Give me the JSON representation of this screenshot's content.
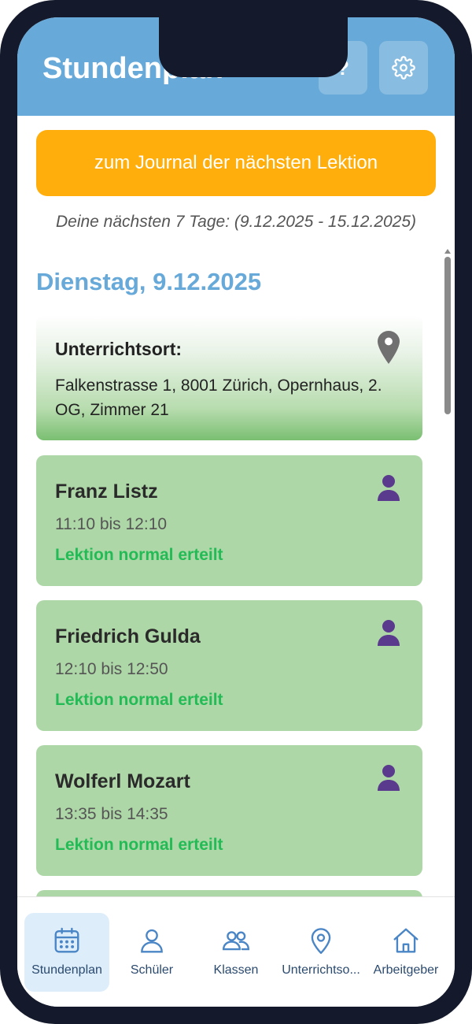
{
  "header": {
    "title": "Stundenplan",
    "help_label": "?"
  },
  "journal_button_label": "zum Journal der nächsten Lektion",
  "range_text": "Deine nächsten 7 Tage: (9.12.2025 - 15.12.2025)",
  "day_heading": "Dienstag, 9.12.2025",
  "location": {
    "label": "Unterrichtsort:",
    "address": "Falkenstrasse 1, 8001 Zürich, Opernhaus, 2. OG, Zimmer 21"
  },
  "lessons": [
    {
      "name": "Franz Listz",
      "time": "11:10 bis 12:10",
      "status": "Lektion normal erteilt"
    },
    {
      "name": "Friedrich Gulda",
      "time": "12:10 bis 12:50",
      "status": "Lektion normal erteilt"
    },
    {
      "name": "Wolferl Mozart",
      "time": "13:35 bis 14:35",
      "status": "Lektion normal erteilt"
    }
  ],
  "nav": [
    {
      "label": "Stundenplan",
      "icon": "calendar-icon",
      "active": true
    },
    {
      "label": "Schüler",
      "icon": "user-icon",
      "active": false
    },
    {
      "label": "Klassen",
      "icon": "users-icon",
      "active": false
    },
    {
      "label": "Unterrichtso...",
      "icon": "map-pin-icon",
      "active": false
    },
    {
      "label": "Arbeitgeber",
      "icon": "home-icon",
      "active": false
    }
  ],
  "colors": {
    "header": "#67a9d8",
    "accent_button": "#ffae0b",
    "card_green": "#aed7a7",
    "status_green": "#22bb55",
    "person_purple": "#5a3a8c"
  }
}
